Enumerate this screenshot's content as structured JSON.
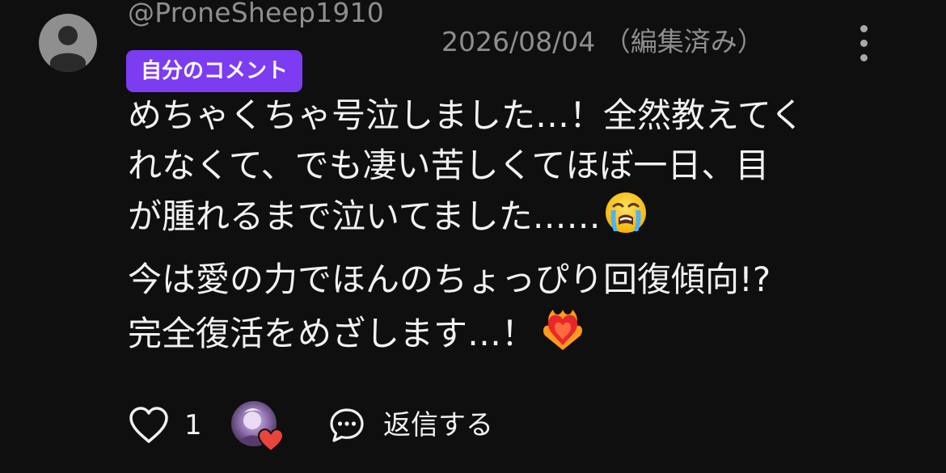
{
  "comment": {
    "author": "@ProneSheep1910",
    "date": "2026/08/04 （編集済み）",
    "own_badge": "自分のコメント",
    "paragraph_1": {
      "line_1": "めちゃくちゃ号泣しました…！全然教えてく",
      "line_2": "れなくて、でも凄い苦しくてほぼ一日、目",
      "line_3": "が腫れるまで泣いてました……"
    },
    "paragraph_2": {
      "line_1": "今は愛の力でほんのちょっぴり回復傾向!?",
      "line_2": "完全復活をめざします…！"
    },
    "emoji_1": "loudly-crying-face",
    "emoji_2": "heart-on-fire"
  },
  "actions": {
    "like_count": "1",
    "reply_label": "返信する"
  },
  "icons": {
    "avatar": "default-user-avatar-icon",
    "more": "three-dots-vertical-icon",
    "like": "heart-outline-icon",
    "creator_heart": "creator-heart-badge-icon",
    "reply": "chat-bubble-icon"
  },
  "colors": {
    "background": "#0f0f0f",
    "badge": "#7b3cf2",
    "muted_text": "#8e8e8e",
    "primary_text": "#f1f1f1",
    "heart": "#e8453c"
  }
}
